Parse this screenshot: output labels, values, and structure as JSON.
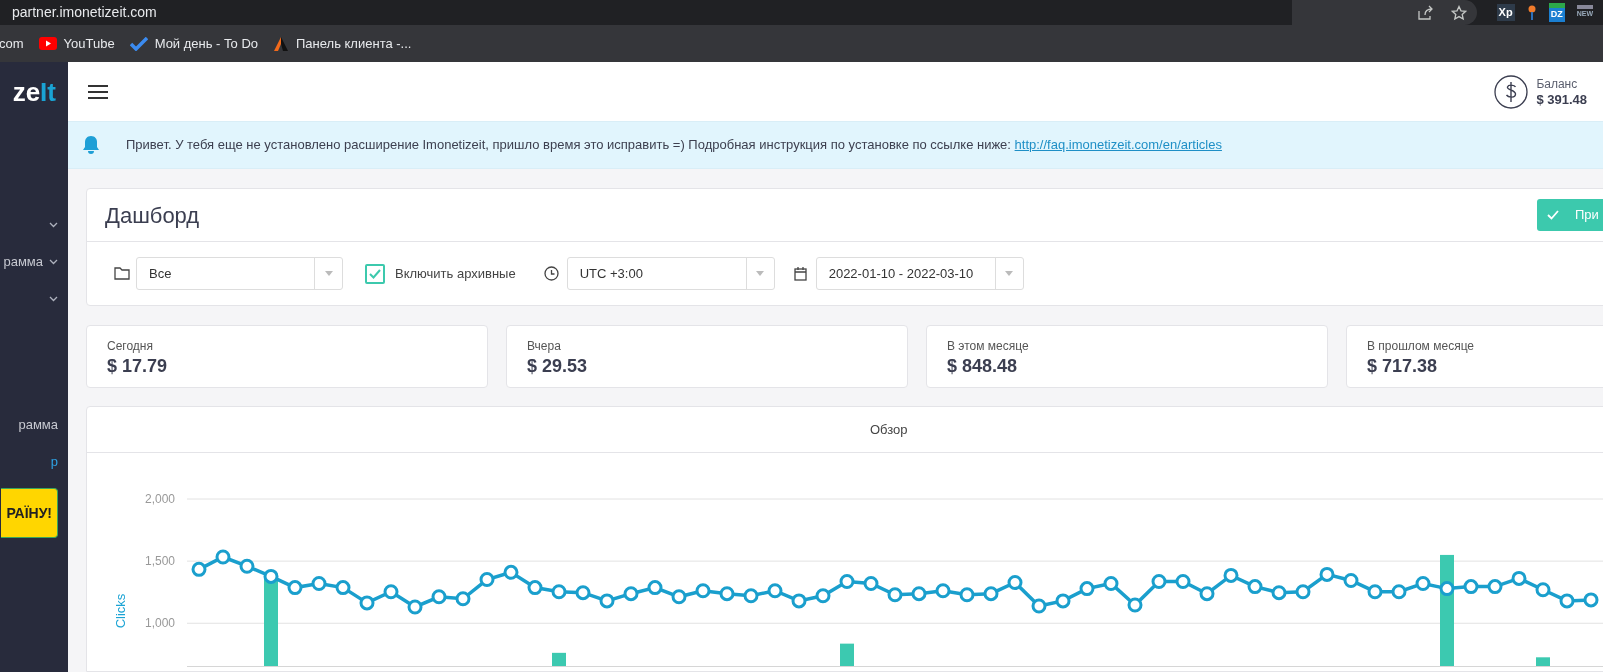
{
  "browser": {
    "url": "partner.imonetizeit.com",
    "bookmarks": [
      {
        "label": "com",
        "kind": "plain"
      },
      {
        "label": "YouTube",
        "kind": "youtube"
      },
      {
        "label": "Мой день - To Do",
        "kind": "todo"
      },
      {
        "label": "Панель клиента -...",
        "kind": "panel"
      }
    ],
    "extensions": [
      "Xp",
      "DZ",
      "NEW"
    ]
  },
  "sidebar": {
    "logo": [
      "ze",
      "It"
    ],
    "items": [
      {
        "kind": "chevron"
      },
      {
        "label": "рамма",
        "kind": "chevron"
      },
      {
        "kind": "chevron"
      },
      {
        "label": "рамма",
        "kind": "plain"
      },
      {
        "label": "р",
        "kind": "link"
      }
    ],
    "cta": "РАЇНУ!"
  },
  "header": {
    "balance_label": "Баланс",
    "balance": "$ 391.48"
  },
  "notice": {
    "text": "Привет. У тебя еще не установлено расширение Imonetizeit, пришло время это исправить =) Подробная инструкция по установке по ссылке ниже:",
    "link": "http://faq.imonetizeit.com/en/articles"
  },
  "dashboard": {
    "title": "Дашборд",
    "action": "При",
    "filters": {
      "group": "Все",
      "include_archived": {
        "label": "Включить архивные",
        "checked": true
      },
      "timezone": "UTC +3:00",
      "date_range": "2022-01-10 - 2022-03-10"
    }
  },
  "stats": [
    {
      "label": "Сегодня",
      "value": "$ 17.79"
    },
    {
      "label": "Вчера",
      "value": "$ 29.53"
    },
    {
      "label": "В этом месяце",
      "value": "$ 848.48"
    },
    {
      "label": "В прошлом месяце",
      "value": "$ 717.38"
    }
  ],
  "overview": {
    "title": "Обзор",
    "chart_data": {
      "type": "line",
      "ylabel": "Clicks",
      "ylim": [
        648,
        2000
      ],
      "yticks": [
        {
          "value": 1000,
          "label": "1,000"
        },
        {
          "value": 1500,
          "label": "1,500"
        },
        {
          "value": 2000,
          "label": "2,000"
        }
      ],
      "series": [
        {
          "type": "line",
          "marker": true,
          "color": "#1a9fcd",
          "values": [
            1434,
            1533,
            1459,
            1377,
            1287,
            1320,
            1287,
            1164,
            1254,
            1131,
            1213,
            1197,
            1352,
            1410,
            1287,
            1254,
            1246,
            1180,
            1238,
            1287,
            1213,
            1262,
            1238,
            1221,
            1262,
            1180,
            1221,
            1336,
            1320,
            1229,
            1238,
            1262,
            1229,
            1238,
            1328,
            1139,
            1180,
            1279,
            1320,
            1147,
            1336,
            1336,
            1238,
            1385,
            1295,
            1246,
            1254,
            1393,
            1344,
            1254,
            1254,
            1320,
            1279,
            1295,
            1295,
            1361,
            1270,
            1180,
            1188
          ]
        },
        {
          "type": "bar",
          "color": "#3cc9b0",
          "values": [
            null,
            null,
            null,
            1400,
            null,
            null,
            null,
            null,
            null,
            null,
            null,
            null,
            null,
            null,
            null,
            762,
            null,
            null,
            null,
            null,
            null,
            null,
            null,
            null,
            null,
            null,
            null,
            836,
            null,
            null,
            null,
            null,
            null,
            null,
            null,
            null,
            null,
            null,
            null,
            null,
            null,
            null,
            null,
            null,
            null,
            null,
            null,
            null,
            null,
            null,
            null,
            null,
            1550,
            null,
            null,
            null,
            726,
            null,
            null
          ]
        }
      ]
    }
  }
}
